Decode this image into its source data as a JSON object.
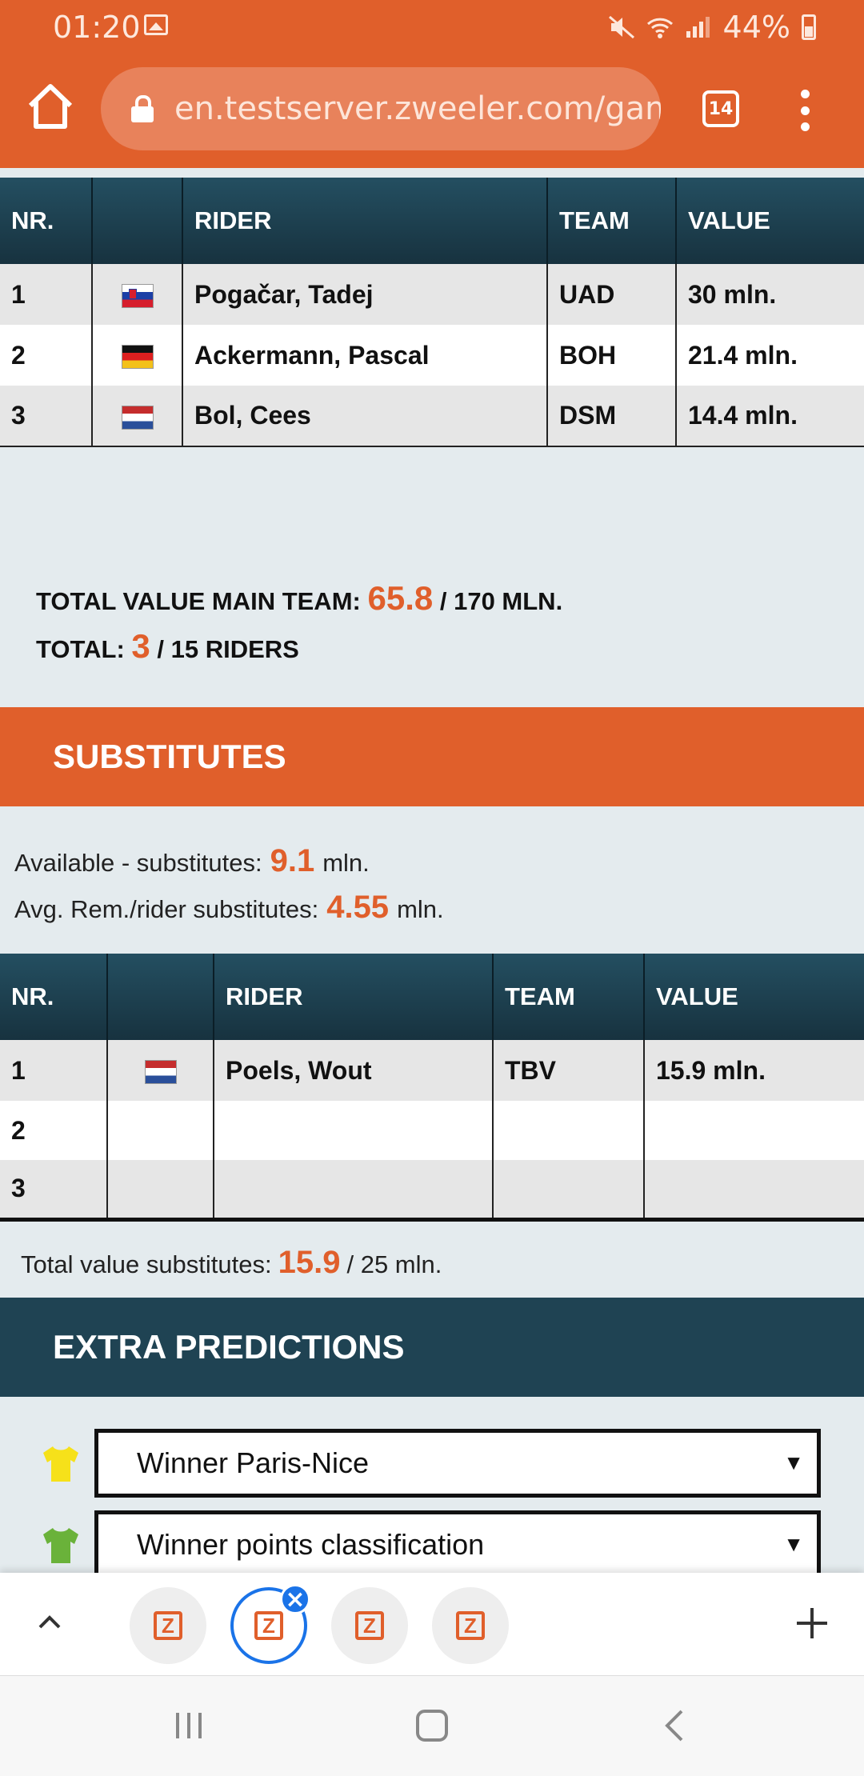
{
  "status_bar": {
    "time": "01:20",
    "battery": "44%"
  },
  "browser": {
    "url": "en.testserver.zweeler.com/gam",
    "tab_count": "14"
  },
  "main_table": {
    "headers": [
      "NR.",
      "",
      "RIDER",
      "TEAM",
      "VALUE"
    ],
    "rows": [
      {
        "nr": "1",
        "flag": "slovenia-flag",
        "rider": "Pogačar, Tadej",
        "team": "UAD",
        "value": "30 mln."
      },
      {
        "nr": "2",
        "flag": "germany-flag",
        "rider": "Ackermann, Pascal",
        "team": "BOH",
        "value": "21.4 mln."
      },
      {
        "nr": "3",
        "flag": "netherlands-flag",
        "rider": "Bol, Cees",
        "team": "DSM",
        "value": "14.4 mln."
      }
    ]
  },
  "totals": {
    "value_label": "TOTAL VALUE MAIN TEAM:",
    "value": "65.8",
    "value_suffix": "/ 170 MLN.",
    "riders_label": "TOTAL:",
    "riders": "3",
    "riders_suffix": "/ 15 RIDERS"
  },
  "substitutes": {
    "title": "SUBSTITUTES",
    "available_label": "Available - substitutes:",
    "available_value": "9.1",
    "available_unit": "mln.",
    "avg_label": "Avg. Rem./rider substitutes:",
    "avg_value": "4.55",
    "avg_unit": "mln.",
    "headers": [
      "NR.",
      "",
      "RIDER",
      "TEAM",
      "VALUE"
    ],
    "rows": [
      {
        "nr": "1",
        "flag": "netherlands-flag",
        "rider": "Poels, Wout",
        "team": "TBV",
        "value": "15.9 mln."
      },
      {
        "nr": "2",
        "flag": "",
        "rider": "",
        "team": "",
        "value": ""
      },
      {
        "nr": "3",
        "flag": "",
        "rider": "",
        "team": "",
        "value": ""
      }
    ],
    "total_label": "Total value substitutes:",
    "total_value": "15.9",
    "total_suffix": "/ 25 mln."
  },
  "extra_predictions": {
    "title": "EXTRA PREDICTIONS",
    "selects": [
      {
        "icon": "yellow-jersey-icon",
        "color": "#f6e11a",
        "value": "Winner Paris-Nice"
      },
      {
        "icon": "green-jersey-icon",
        "color": "#6ab23a",
        "value": "Winner points classification"
      }
    ]
  },
  "tab_strip": {
    "tab_icon_letter": "Z"
  },
  "colors": {
    "accent": "#e05f2b",
    "navy": "#1f4353",
    "chrome_blue": "#1a73e8"
  }
}
